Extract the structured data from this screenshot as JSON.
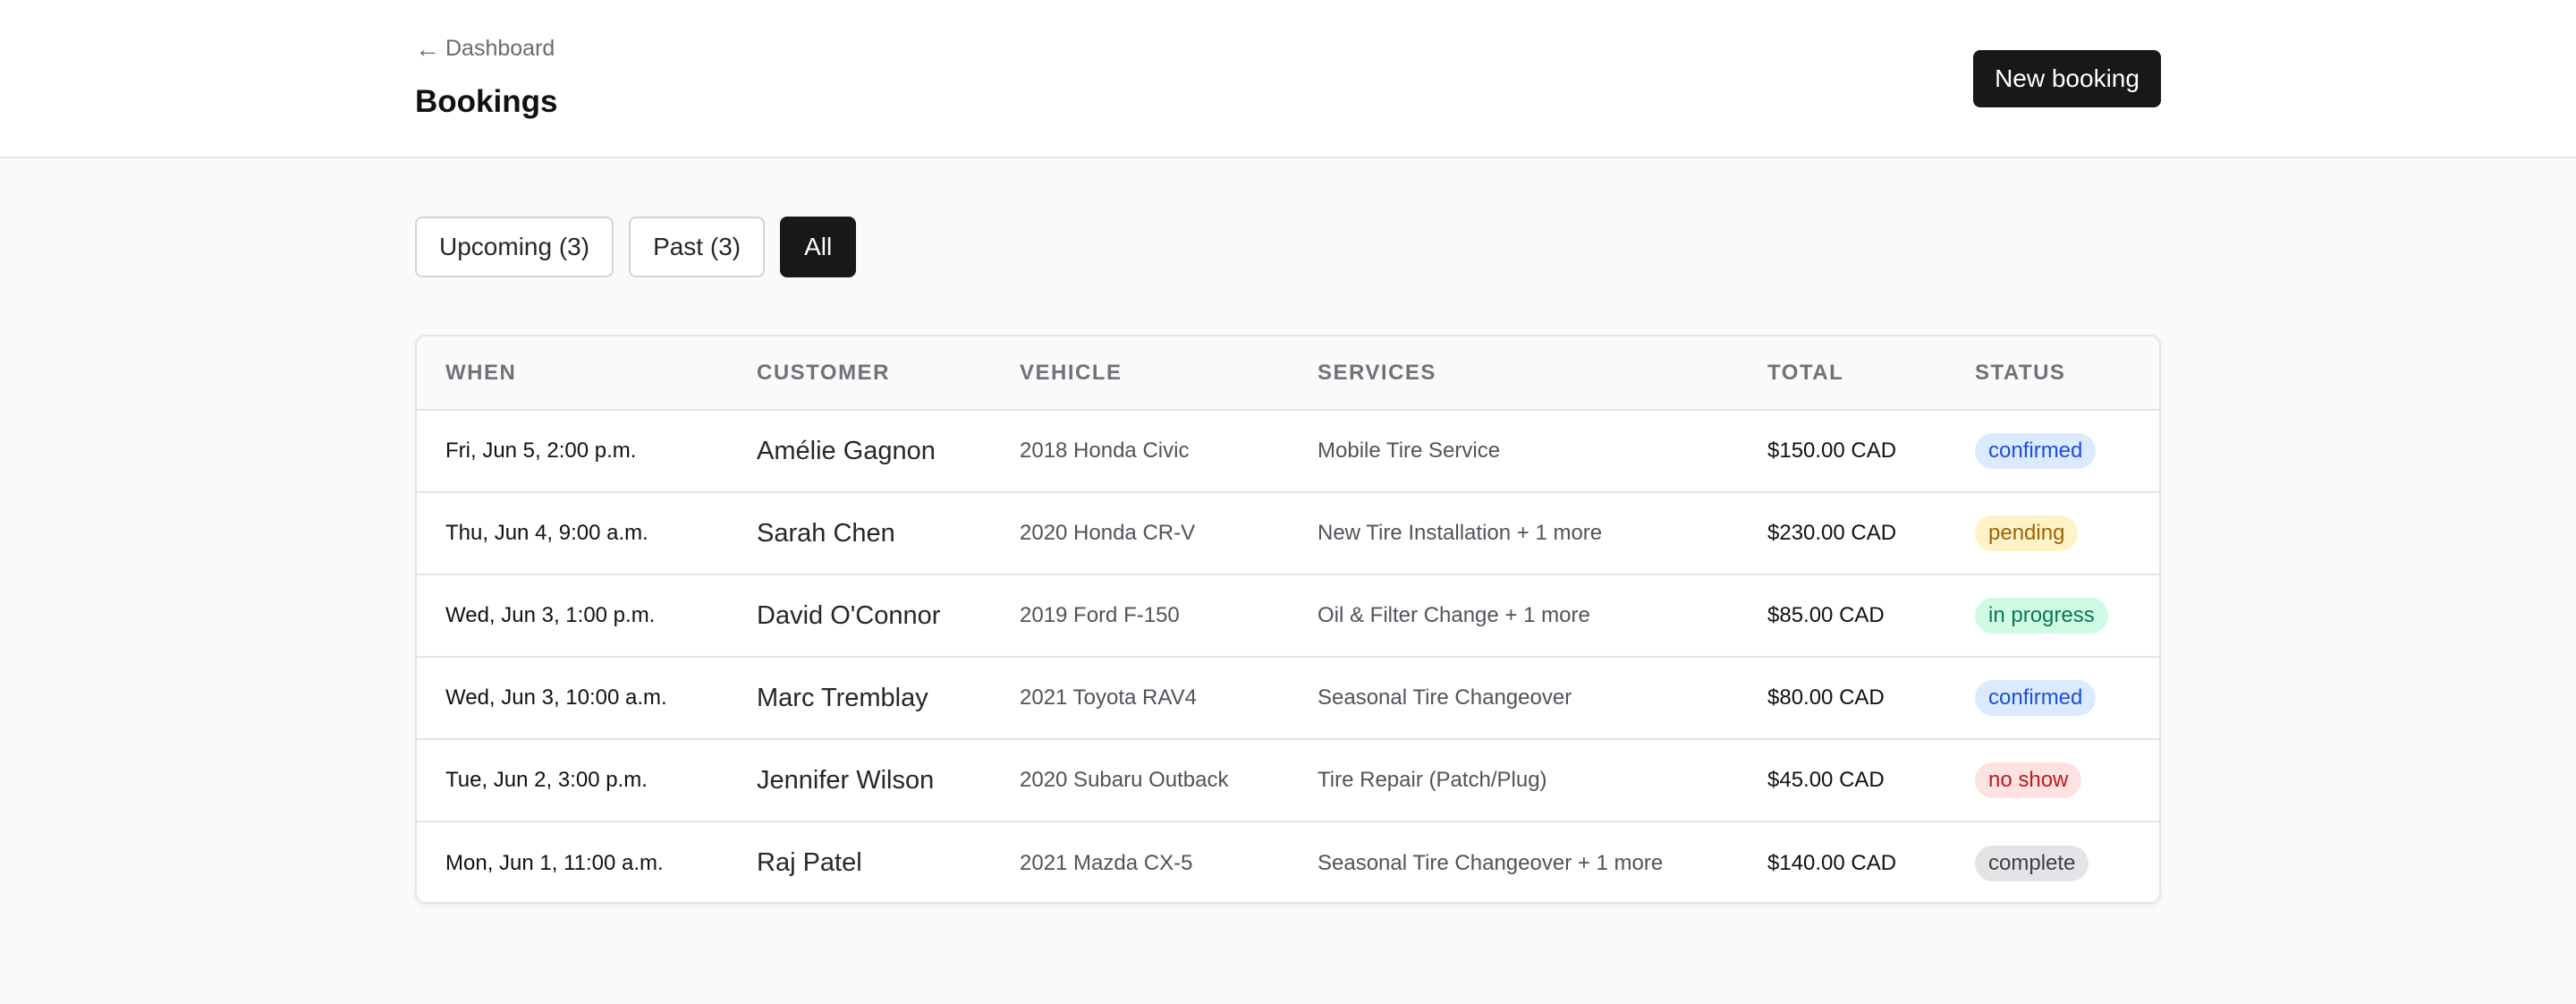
{
  "header": {
    "back_arrow": "←",
    "back_label": "Dashboard",
    "title": "Bookings",
    "new_booking_label": "New booking"
  },
  "filters": [
    {
      "label": "Upcoming (3)",
      "active": false
    },
    {
      "label": "Past (3)",
      "active": false
    },
    {
      "label": "All",
      "active": true
    }
  ],
  "table": {
    "columns": [
      "WHEN",
      "CUSTOMER",
      "VEHICLE",
      "SERVICES",
      "TOTAL",
      "STATUS"
    ],
    "rows": [
      {
        "when": "Fri, Jun 5, 2:00 p.m.",
        "customer": "Amélie Gagnon",
        "vehicle": "2018 Honda Civic",
        "services": "Mobile Tire Service",
        "total": "$150.00 CAD",
        "status": "confirmed"
      },
      {
        "when": "Thu, Jun 4, 9:00 a.m.",
        "customer": "Sarah Chen",
        "vehicle": "2020 Honda CR-V",
        "services": "New Tire Installation + 1 more",
        "total": "$230.00 CAD",
        "status": "pending"
      },
      {
        "when": "Wed, Jun 3, 1:00 p.m.",
        "customer": "David O'Connor",
        "vehicle": "2019 Ford F-150",
        "services": "Oil & Filter Change + 1 more",
        "total": "$85.00 CAD",
        "status": "in progress"
      },
      {
        "when": "Wed, Jun 3, 10:00 a.m.",
        "customer": "Marc Tremblay",
        "vehicle": "2021 Toyota RAV4",
        "services": "Seasonal Tire Changeover",
        "total": "$80.00 CAD",
        "status": "confirmed"
      },
      {
        "when": "Tue, Jun 2, 3:00 p.m.",
        "customer": "Jennifer Wilson",
        "vehicle": "2020 Subaru Outback",
        "services": "Tire Repair (Patch/Plug)",
        "total": "$45.00 CAD",
        "status": "no show"
      },
      {
        "when": "Mon, Jun 1, 11:00 a.m.",
        "customer": "Raj Patel",
        "vehicle": "2021 Mazda CX-5",
        "services": "Seasonal Tire Changeover + 1 more",
        "total": "$140.00 CAD",
        "status": "complete"
      }
    ]
  },
  "colors": {
    "primary": "#18181b",
    "background": "#fafafa",
    "confirmed": "#dbeafe",
    "pending": "#fef3c7",
    "in_progress": "#d1fae5",
    "no_show": "#fee2e2",
    "complete": "#e4e4e7"
  }
}
